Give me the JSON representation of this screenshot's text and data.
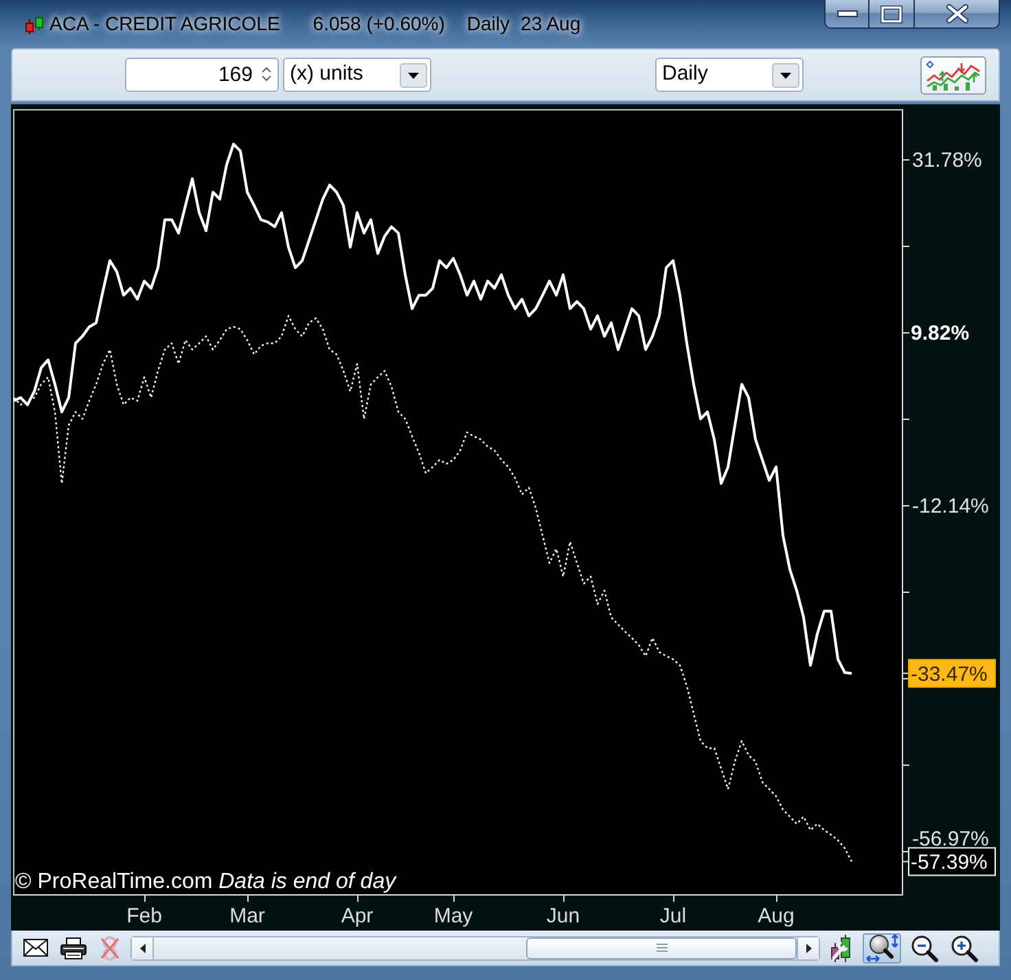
{
  "window": {
    "title": "ACA - CREDIT AGRICOLE",
    "price": "6.058 (+0.60%)",
    "period": "Daily",
    "date": "23 Aug"
  },
  "toolbar": {
    "count_field": {
      "value": "169"
    },
    "units_dropdown": {
      "value": "(x) units"
    },
    "period_dropdown": {
      "value": "Daily"
    }
  },
  "chart": {
    "chart_data": {
      "type": "line",
      "categories": [
        null,
        null,
        null,
        null,
        null,
        null,
        null,
        null,
        null,
        null,
        null,
        null,
        null,
        null,
        null,
        null,
        null,
        null,
        null,
        "Feb",
        null,
        null,
        null,
        null,
        null,
        null,
        null,
        null,
        null,
        null,
        null,
        null,
        null,
        null,
        "Mar",
        null,
        null,
        null,
        null,
        null,
        null,
        null,
        null,
        null,
        null,
        null,
        null,
        null,
        null,
        null,
        "Apr",
        null,
        null,
        null,
        null,
        null,
        null,
        null,
        null,
        null,
        null,
        null,
        null,
        null,
        "May",
        null,
        null,
        null,
        null,
        null,
        null,
        null,
        null,
        null,
        null,
        null,
        null,
        null,
        null,
        null,
        "Jun",
        null,
        null,
        null,
        null,
        null,
        null,
        null,
        null,
        null,
        null,
        null,
        null,
        null,
        null,
        null,
        "Jul",
        null,
        null,
        null,
        null,
        null,
        null,
        null,
        null,
        null,
        null,
        null,
        null,
        null,
        null,
        "Aug",
        null,
        null,
        null,
        null,
        null,
        null,
        null,
        null,
        null,
        null,
        null
      ],
      "ylim": [
        -61.63,
        38.05
      ],
      "yticks": [
        {
          "value": 31.78,
          "label": "31.78%"
        },
        {
          "value": 9.82,
          "label": "9.82%"
        },
        {
          "value": -12.14,
          "label": "-12.14%"
        },
        {
          "value": -56.97,
          "label": "-56.97%"
        }
      ],
      "series": [
        {
          "color": "#ffffff",
          "values": [
            1.1,
            1.5,
            0.6,
            2.3,
            5.3,
            6.3,
            3.2,
            -0.3,
            1.5,
            8.4,
            9.3,
            10.5,
            11.0,
            15.1,
            18.9,
            17.5,
            14.5,
            15.4,
            14.0,
            16.3,
            15.4,
            18.0,
            24.1,
            24.1,
            22.4,
            25.9,
            29.3,
            25.0,
            22.7,
            27.6,
            26.7,
            31.1,
            33.7,
            32.8,
            27.6,
            25.9,
            24.1,
            23.8,
            23.2,
            25.0,
            20.6,
            18.0,
            18.9,
            21.5,
            24.1,
            26.7,
            28.5,
            27.6,
            25.9,
            20.6,
            25.0,
            22.4,
            24.1,
            19.8,
            22.0,
            23.2,
            22.4,
            17.1,
            12.8,
            14.5,
            14.5,
            15.4,
            18.9,
            18.0,
            19.2,
            17.1,
            14.5,
            16.3,
            14.0,
            16.3,
            15.4,
            17.1,
            14.5,
            12.8,
            14.0,
            11.9,
            12.8,
            14.5,
            16.3,
            14.5,
            17.1,
            12.8,
            13.7,
            12.8,
            10.2,
            11.9,
            9.3,
            11.0,
            7.6,
            10.2,
            12.8,
            11.9,
            7.6,
            9.3,
            11.9,
            18.0,
            18.9,
            14.5,
            8.4,
            3.2,
            -1.2,
            -0.3,
            -3.8,
            -9.4,
            -7.3,
            -2.0,
            3.2,
            1.5,
            -3.8,
            -6.4,
            -9.0,
            -7.3,
            -16.0,
            -20.3,
            -23.0,
            -26.4,
            -32.5,
            -28.5,
            -25.6,
            -25.6,
            -31.7,
            -33.4,
            -33.5
          ]
        },
        {
          "color": "#ffffff",
          "line_style": "dotted",
          "values": [
            1.5,
            0.6,
            1.1,
            1.5,
            3.2,
            4.1,
            -0.3,
            -9.4,
            -2.0,
            -0.3,
            -1.2,
            1.1,
            3.2,
            5.8,
            7.6,
            3.2,
            0.6,
            1.5,
            1.1,
            4.1,
            1.5,
            4.9,
            7.6,
            8.4,
            5.8,
            8.8,
            7.6,
            8.4,
            9.3,
            7.6,
            8.8,
            10.2,
            10.5,
            10.2,
            8.8,
            7.0,
            8.1,
            8.4,
            8.4,
            9.3,
            11.9,
            10.2,
            9.3,
            11.0,
            11.6,
            10.2,
            7.6,
            7.0,
            4.9,
            2.3,
            5.8,
            -1.2,
            3.2,
            4.1,
            4.9,
            2.9,
            -0.3,
            -1.2,
            -3.4,
            -5.5,
            -8.1,
            -7.3,
            -6.4,
            -6.9,
            -6.4,
            -5.2,
            -2.9,
            -3.4,
            -3.8,
            -4.7,
            -5.2,
            -6.4,
            -7.3,
            -8.7,
            -10.8,
            -9.9,
            -12.5,
            -16.0,
            -19.5,
            -17.7,
            -21.2,
            -16.8,
            -19.5,
            -22.1,
            -21.2,
            -24.7,
            -23.0,
            -26.4,
            -27.3,
            -28.2,
            -29.0,
            -29.9,
            -31.3,
            -29.0,
            -30.8,
            -31.3,
            -31.7,
            -32.5,
            -35.1,
            -38.6,
            -42.1,
            -43.0,
            -43.0,
            -45.6,
            -48.2,
            -44.7,
            -42.1,
            -43.9,
            -44.7,
            -47.3,
            -48.2,
            -49.1,
            -50.8,
            -51.7,
            -52.6,
            -51.7,
            -53.4,
            -52.6,
            -53.4,
            -54.0,
            -54.7,
            -55.7,
            -57.4
          ]
        }
      ]
    },
    "ytick_styles": [
      {
        "bold": false
      },
      {
        "bold": true
      },
      {
        "bold": false
      },
      {
        "bold": false
      }
    ],
    "value_tags": [
      {
        "text": "-33.47%",
        "highlighted": true
      },
      {
        "text": "-57.39%",
        "highlighted": false
      }
    ],
    "note": "© ProRealTime.com *Data is end of day*"
  },
  "footer": {
    "left_tools": [
      {
        "kind": "mail",
        "selected": false
      },
      {
        "kind": "print",
        "selected": false
      },
      {
        "kind": "unlink",
        "selected": false
      }
    ],
    "right_tools": [
      {
        "kind": "indicator_settings",
        "selected": false
      },
      {
        "kind": "zoom_fit",
        "selected": true
      },
      {
        "kind": "zoom_out",
        "selected": false
      },
      {
        "kind": "zoom_in",
        "selected": false
      }
    ]
  }
}
